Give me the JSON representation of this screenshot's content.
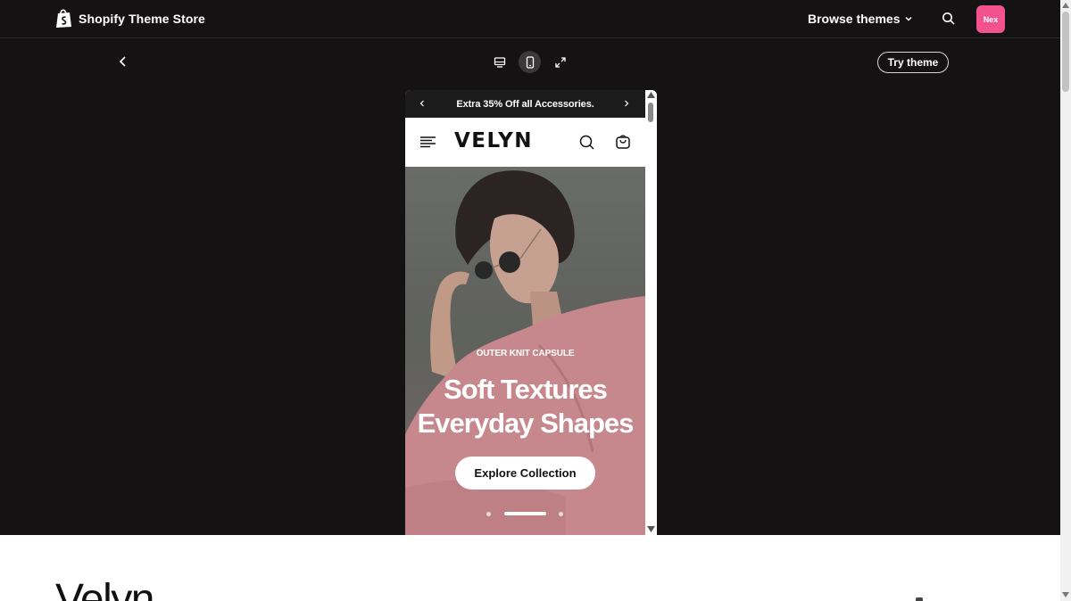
{
  "topnav": {
    "brand": "Shopify Theme Store",
    "browse_label": "Browse themes",
    "avatar_initials": "Nex",
    "icons": [
      "shopify-bag-icon",
      "chevron-down-icon",
      "search-icon"
    ]
  },
  "toolbar": {
    "try_label": "Try theme",
    "views": [
      "desktop-view",
      "mobile-view",
      "fullscreen-view"
    ],
    "active_view": "mobile-view"
  },
  "preview": {
    "announcement": "Extra 35% Off all Accessories.",
    "logo": "VELYN",
    "hero": {
      "eyebrow": "OUTER KNIT CAPSULE",
      "title_line1": "Soft Textures",
      "title_line2": "Everyday Shapes",
      "button": "Explore Collection"
    },
    "slides_total": 3,
    "slide_active": 2
  },
  "theme": {
    "name": "Velyn"
  },
  "colors": {
    "background_dark": "#141213",
    "avatar": "#f2538f",
    "announcement_bar": "#1c1b1c"
  }
}
